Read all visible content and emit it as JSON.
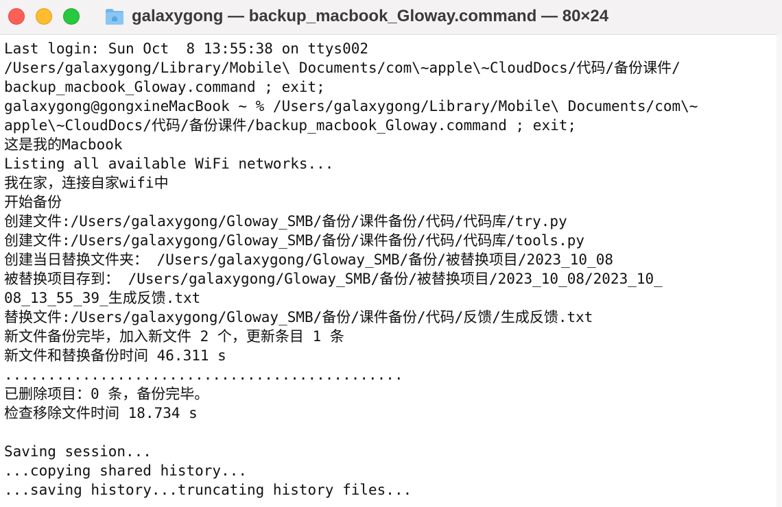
{
  "window": {
    "title": "galaxygong — backup_macbook_Gloway.command — 80×24",
    "icon": "folder-icon"
  },
  "colors": {
    "close": "#fe5f57",
    "minimize": "#febc2e",
    "zoom": "#28c840",
    "text": "#111111"
  },
  "terminal": {
    "lines": [
      "Last login: Sun Oct  8 13:55:38 on ttys002",
      "/Users/galaxygong/Library/Mobile\\ Documents/com\\~apple\\~CloudDocs/代码/备份课件/",
      "backup_macbook_Gloway.command ; exit;",
      "galaxygong@gongxineMacBook ~ % /Users/galaxygong/Library/Mobile\\ Documents/com\\~",
      "apple\\~CloudDocs/代码/备份课件/backup_macbook_Gloway.command ; exit;",
      "这是我的Macbook",
      "Listing all available WiFi networks...",
      "我在家，连接自家wifi中",
      "开始备份",
      "创建文件:/Users/galaxygong/Gloway_SMB/备份/课件备份/代码/代码库/try.py",
      "创建文件:/Users/galaxygong/Gloway_SMB/备份/课件备份/代码/代码库/tools.py",
      "创建当日替换文件夹： /Users/galaxygong/Gloway_SMB/备份/被替换项目/2023_10_08",
      "被替换项目存到： /Users/galaxygong/Gloway_SMB/备份/被替换项目/2023_10_08/2023_10_",
      "08_13_55_39_生成反馈.txt",
      "替换文件:/Users/galaxygong/Gloway_SMB/备份/课件备份/代码/反馈/生成反馈.txt",
      "新文件备份完毕，加入新文件 2 个，更新条目 1 条",
      "新文件和替换备份时间 46.311 s",
      "..............................................",
      "已删除项目：0 条，备份完毕。",
      "检查移除文件时间 18.734 s",
      "",
      "Saving session...",
      "...copying shared history...",
      "...saving history...truncating history files..."
    ]
  }
}
